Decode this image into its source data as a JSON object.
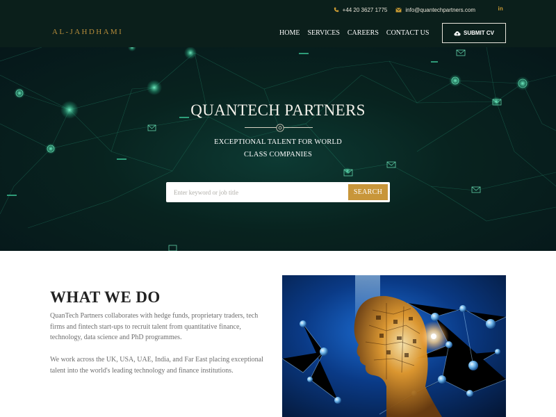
{
  "header": {
    "phone": "+44 20 3627 1775",
    "email": "info@quantechpartners.com",
    "linkedin": "in",
    "logo": "AL-JAHDHAMI",
    "nav": [
      {
        "label": "HOME"
      },
      {
        "label": "SERVICES"
      },
      {
        "label": "CAREERS"
      },
      {
        "label": "CONTACT US"
      }
    ],
    "submit_cv": "SUBMIT CV"
  },
  "hero": {
    "title": "QUANTECH PARTNERS",
    "subtitle_line1": "EXCEPTIONAL TALENT FOR WORLD",
    "subtitle_line2": "CLASS COMPANIES",
    "search_placeholder": "Enter keyword or job title",
    "search_button": "SEARCH"
  },
  "what_we_do": {
    "title": "WHAT WE DO",
    "paragraph1": "QuanTech Partners collaborates with hedge funds, proprietary traders, tech firms and fintech start-ups to recruit talent from quantitative finance, technology, data science and PhD programmes.",
    "paragraph2": "We work across the UK, USA, UAE, India, and Far East placing exceptional talent into the world's leading technology and finance institutions."
  },
  "colors": {
    "header_bg": "#0b1f1b",
    "accent_gold": "#c8963a",
    "hero_bg": "#08231f",
    "network_green": "#2fbf8f"
  },
  "icons": {
    "phone": "phone-icon",
    "email": "envelope-icon",
    "linkedin": "linkedin-icon",
    "upload": "cloud-upload-icon"
  }
}
